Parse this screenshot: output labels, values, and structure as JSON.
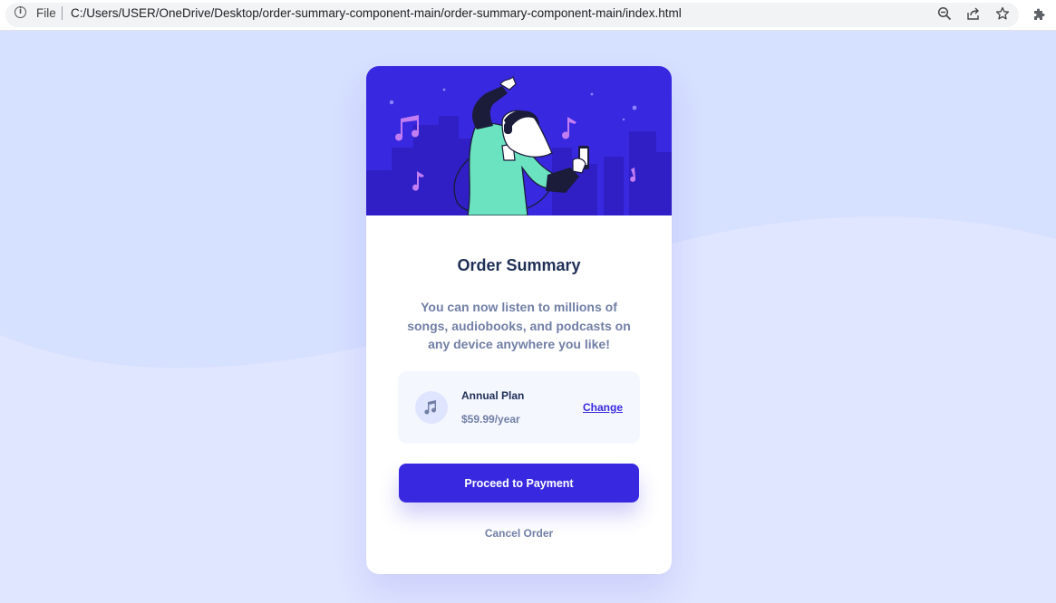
{
  "browser": {
    "scheme_label": "File",
    "url": "C:/Users/USER/OneDrive/Desktop/order-summary-component-main/order-summary-component-main/index.html",
    "icons": [
      "info-icon",
      "zoom-icon",
      "share-icon",
      "star-icon",
      "extensions-icon"
    ]
  },
  "colors": {
    "page_bg": "#e0e6ff",
    "wave": "#d6e0ff",
    "primary": "#3829e0",
    "hero_bg": "#3829e0",
    "title": "#1f2f56",
    "body_text": "#717fa6",
    "plan_bg": "#f5f7ff"
  },
  "card": {
    "hero_icon": "music-listener-illustration",
    "title": "Order Summary",
    "description": "You can now listen to millions of songs, audiobooks, and podcasts on any device anywhere you like!",
    "plan": {
      "icon": "music-note-icon",
      "name": "Annual Plan",
      "price": "$59.99/year",
      "change_label": "Change"
    },
    "proceed_label": "Proceed to Payment",
    "cancel_label": "Cancel Order"
  }
}
